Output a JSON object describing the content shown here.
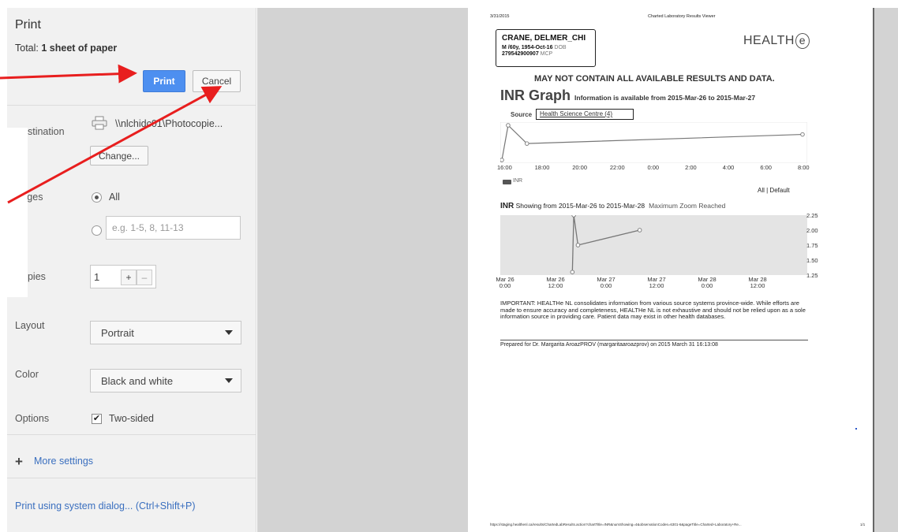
{
  "dialog": {
    "title": "Print",
    "total_prefix": "Total: ",
    "total_value": "1 sheet of paper",
    "print_label": "Print",
    "cancel_label": "Cancel",
    "destination_label": "Destination",
    "destination_value": "\\\\nlchidc01\\Photocopie...",
    "change_label": "Change...",
    "pages_label": "Pages",
    "pages_all": "All",
    "pages_placeholder": "e.g. 1-5, 8, 11-13",
    "copies_label": "Copies",
    "copies_value": "1",
    "copies_plus": "+",
    "copies_minus": "–",
    "layout_label": "Layout",
    "layout_value": "Portrait",
    "color_label": "Color",
    "color_value": "Black and white",
    "options_label": "Options",
    "two_sided_label": "Two-sided",
    "two_sided_checked": true,
    "more_settings": "More settings",
    "system_dialog": "Print using system dialog... (Ctrl+Shift+P)"
  },
  "preview": {
    "date": "3/31/2015",
    "header": "Charted Laboratory Results Viewer",
    "patient_name": "CRANE, DELMER_CHI",
    "patient_demo": "M /60y, 1954-Oct-16",
    "patient_demo_suffix": "DOB",
    "patient_mcp": "279542900907",
    "patient_mcp_suffix": "MCP",
    "logo": "HEALTH",
    "logo_e": "e",
    "disclaimer": "MAY NOT CONTAIN ALL AVAILABLE RESULTS AND DATA.",
    "graph_title": "INR Graph",
    "graph_info": "Information is available from 2015-Mar-26 to 2015-Mar-27",
    "source_label": "Source",
    "source_value": "Health Science Centre (4)",
    "legend_label": "INR",
    "all_default": "All | Default",
    "chart2_name": "INR",
    "chart2_range": "Showing from 2015-Mar-26 to 2015-Mar-28",
    "chart2_zoom": "Maximum Zoom Reached",
    "important": "IMPORTANT: HEALTHe NL consolidates information from various source systems province-wide. While efforts are made to ensure accuracy and completeness, HEALTHe NL is not exhaustive and should not be relied upon as a sole information source in providing care. Patient data may exist in other health databases.",
    "prepared": "Prepared for Dr. Margarita AroazPROV (margaritaaroazprov) on 2015 March 31 16:13:08",
    "footer_url": "https://staging.healthenl.ca/results/ChartedLabResults.action?chartTitle=INR&numShowing=4&observationCodes=6301-6&pageTitle=Charted+Laboratory+Re...",
    "footer_page": "1/1"
  },
  "chart_data": [
    {
      "type": "line",
      "series": [
        {
          "name": "INR",
          "x": [
            "16:00",
            "16:20",
            "17:20",
            "08:00"
          ],
          "values": [
            1.3,
            2.25,
            1.75,
            2.0
          ]
        }
      ],
      "x_tick_labels": [
        "16:00",
        "18:00",
        "20:00",
        "22:00",
        "0:00",
        "2:00",
        "4:00",
        "6:00",
        "8:00"
      ],
      "grid": false
    },
    {
      "type": "line",
      "series": [
        {
          "name": "INR",
          "x": [
            "Mar 26 16:00",
            "Mar 26 16:20",
            "Mar 26 17:20",
            "Mar 27 08:00"
          ],
          "values": [
            1.3,
            2.25,
            1.75,
            2.0
          ]
        }
      ],
      "x_tick_labels": [
        "Mar 26\n0:00",
        "Mar 26\n12:00",
        "Mar 27\n0:00",
        "Mar 27\n12:00",
        "Mar 28\n0:00",
        "Mar 28\n12:00"
      ],
      "y_tick_labels": [
        "2.25",
        "2.00",
        "1.75",
        "1.50",
        "1.25"
      ],
      "ylim": [
        1.25,
        2.25
      ]
    }
  ],
  "colors": {
    "print_button": "#4d8ff0",
    "link": "#3a6fbf",
    "arrow": "#e81e1e",
    "chart_bg": "#e4e4e4"
  }
}
